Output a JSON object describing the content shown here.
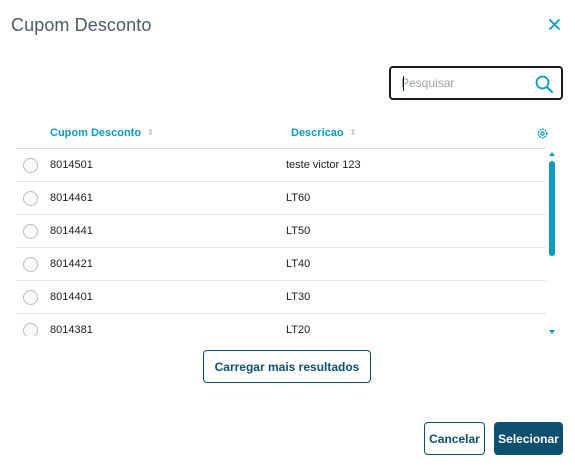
{
  "dialog": {
    "title": "Cupom Desconto"
  },
  "search": {
    "placeholder": "Pesquisar",
    "value": ""
  },
  "table": {
    "columns": [
      {
        "label": "Cupom Desconto"
      },
      {
        "label": "Descricao"
      }
    ],
    "rows": [
      {
        "code": "8014501",
        "description": "teste victor 123"
      },
      {
        "code": "8014461",
        "description": "LT60"
      },
      {
        "code": "8014441",
        "description": "LT50"
      },
      {
        "code": "8014421",
        "description": "LT40"
      },
      {
        "code": "8014401",
        "description": "LT30"
      },
      {
        "code": "8014381",
        "description": "LT20"
      }
    ]
  },
  "actions": {
    "load_more_label": "Carregar mais resultados",
    "cancel_label": "Cancelar",
    "select_label": "Selecionar"
  },
  "icons": {
    "close": "close-icon",
    "search": "search-icon",
    "settings": "gear-icon",
    "sort": "sort-icon"
  },
  "colors": {
    "accent": "#0c9abe",
    "primary": "#0d4f6e",
    "title": "#4a5c60"
  }
}
